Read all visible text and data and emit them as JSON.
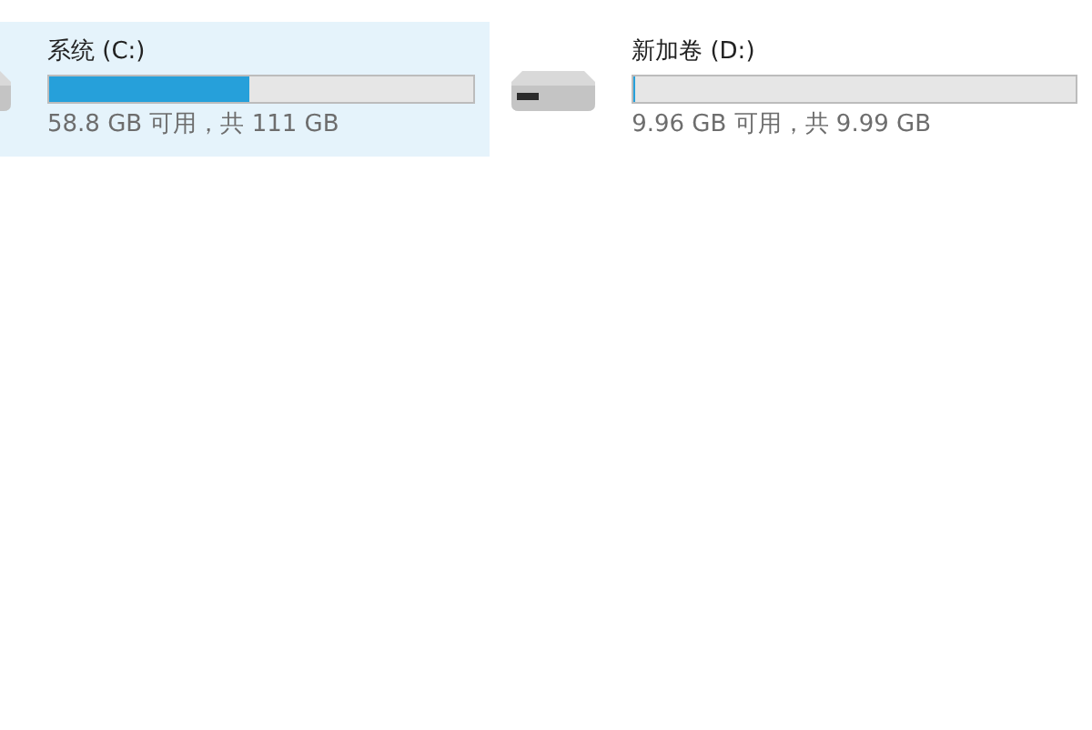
{
  "drives": [
    {
      "name": "系统 (C:)",
      "level": 0.47,
      "space": "58.8 GB 可用，共 111 GB",
      "selected": true
    },
    {
      "name": "新加卷 (D:)",
      "level": 0.003,
      "space": "9.96 GB 可用，共 9.99 GB",
      "selected": false
    }
  ]
}
